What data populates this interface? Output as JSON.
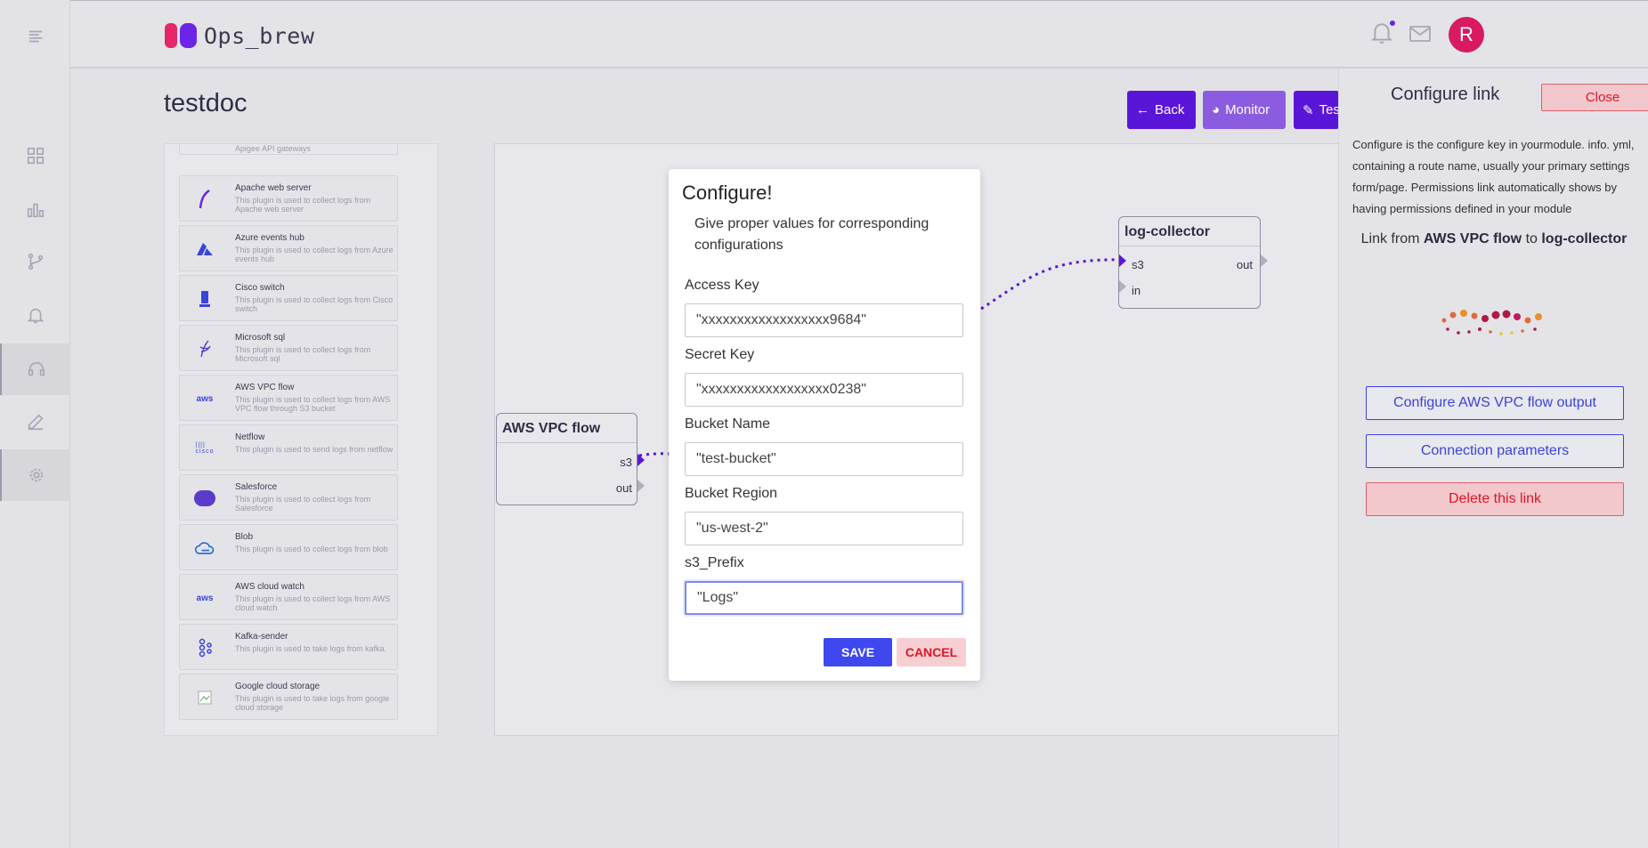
{
  "app": {
    "name": "Ops_brew"
  },
  "header": {
    "avatar_initial": "R"
  },
  "sidebar": {
    "items": [
      "menu-icon",
      "dashboard-icon",
      "chart-icon",
      "branch-icon",
      "bell-icon",
      "headset-icon",
      "edit-icon",
      "gear-icon"
    ]
  },
  "page": {
    "title": "testdoc",
    "buttons": {
      "back": "Back",
      "monitor": "Monitor",
      "test": "Test"
    }
  },
  "plugins": {
    "top_partial": "Apigee API gateways",
    "items": [
      {
        "name": "Apache web server",
        "desc": "This plugin is used to collect logs from Apache web server",
        "icon": "feather-icon"
      },
      {
        "name": "Azure events hub",
        "desc": "This plugin is used to collect logs from Azure events hub",
        "icon": "azure-icon"
      },
      {
        "name": "Cisco switch",
        "desc": "This plugin is used to collect logs from Cisco switch",
        "icon": "switch-icon"
      },
      {
        "name": "Microsoft sql",
        "desc": "This plugin is used to collect logs from Microsoft sql",
        "icon": "sql-icon"
      },
      {
        "name": "AWS VPC flow",
        "desc": "This plugin is used to collect logs from AWS VPC flow through S3 bucket",
        "icon": "aws-icon"
      },
      {
        "name": "Netflow",
        "desc": "This plugin is used to send logs from netflow",
        "icon": "cisco-icon"
      },
      {
        "name": "Salesforce",
        "desc": "This plugin is used to collect logs from Salesforce",
        "icon": "salesforce-icon"
      },
      {
        "name": "Blob",
        "desc": "This plugin is used to collect logs from blob",
        "icon": "cloud-icon"
      },
      {
        "name": "AWS cloud watch",
        "desc": "This plugin is used to collect logs from AWS cloud watch",
        "icon": "aws-icon"
      },
      {
        "name": "Kafka-sender",
        "desc": "This plugin is used to take logs from kafka.",
        "icon": "kafka-icon"
      },
      {
        "name": "Google cloud storage",
        "desc": "This plugin is used to take logs from google cloud storage",
        "icon": "broken-image-icon"
      }
    ]
  },
  "canvas": {
    "node_source": {
      "title": "AWS VPC flow",
      "ports": [
        "s3",
        "out"
      ]
    },
    "node_target": {
      "title": "log-collector",
      "ports_in": [
        "s3",
        "in"
      ],
      "ports_out": [
        "out"
      ]
    }
  },
  "modal": {
    "title": "Configure!",
    "subtitle": "Give proper values for corresponding configurations",
    "fields": [
      {
        "label": "Access Key",
        "value": "\"xxxxxxxxxxxxxxxxxx9684\""
      },
      {
        "label": "Secret Key",
        "value": "\"xxxxxxxxxxxxxxxxxx0238\""
      },
      {
        "label": "Bucket Name",
        "value": "\"test-bucket\""
      },
      {
        "label": "Bucket Region",
        "value": "\"us-west-2\""
      },
      {
        "label": "s3_Prefix",
        "value": "\"Logs\""
      }
    ],
    "save": "SAVE",
    "cancel": "CANCEL"
  },
  "right_panel": {
    "title": "Configure link",
    "close": "Close",
    "description": "Configure is the configure key in yourmodule. info. yml, containing a route name, usually your primary settings form/page. Permissions link automatically shows by having permissions defined in your module",
    "link_prefix": "Link from",
    "link_from": "AWS VPC flow",
    "link_mid": "to",
    "link_to": "log-collector",
    "buttons": {
      "configure_output": "Configure AWS VPC flow output",
      "connection": "Connection parameters",
      "delete": "Delete this link"
    }
  },
  "colors": {
    "primary": "#5a16d8",
    "monitor": "#8c5ce0",
    "save": "#3f48ee",
    "danger": "#e01426",
    "brand_pink": "#e6266b",
    "avatar": "#d81b60"
  }
}
